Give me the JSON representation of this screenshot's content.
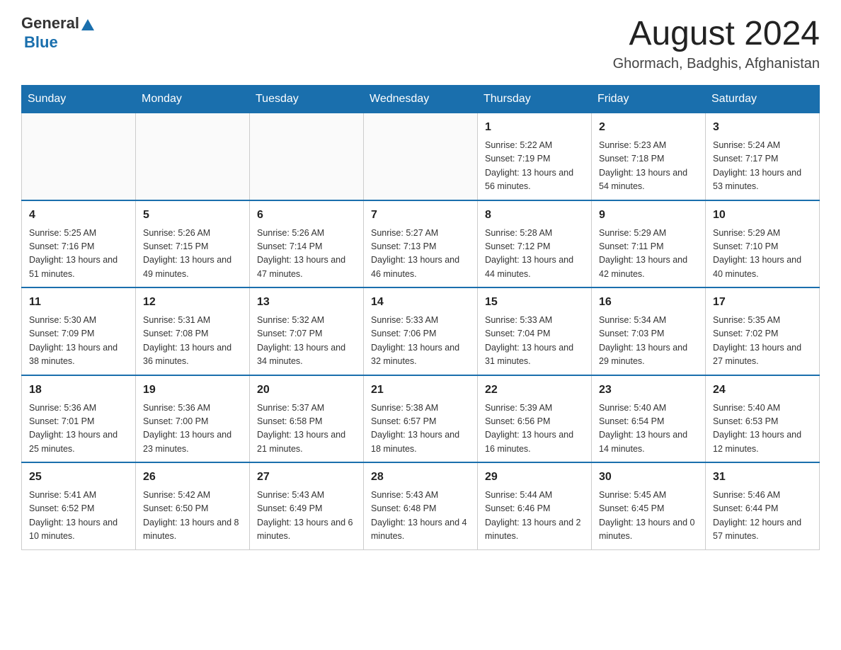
{
  "header": {
    "logo": {
      "general": "General",
      "blue": "Blue"
    },
    "title": "August 2024",
    "location": "Ghormach, Badghis, Afghanistan"
  },
  "days_of_week": [
    "Sunday",
    "Monday",
    "Tuesday",
    "Wednesday",
    "Thursday",
    "Friday",
    "Saturday"
  ],
  "weeks": [
    {
      "days": [
        {
          "number": "",
          "info": ""
        },
        {
          "number": "",
          "info": ""
        },
        {
          "number": "",
          "info": ""
        },
        {
          "number": "",
          "info": ""
        },
        {
          "number": "1",
          "info": "Sunrise: 5:22 AM\nSunset: 7:19 PM\nDaylight: 13 hours and 56 minutes."
        },
        {
          "number": "2",
          "info": "Sunrise: 5:23 AM\nSunset: 7:18 PM\nDaylight: 13 hours and 54 minutes."
        },
        {
          "number": "3",
          "info": "Sunrise: 5:24 AM\nSunset: 7:17 PM\nDaylight: 13 hours and 53 minutes."
        }
      ]
    },
    {
      "days": [
        {
          "number": "4",
          "info": "Sunrise: 5:25 AM\nSunset: 7:16 PM\nDaylight: 13 hours and 51 minutes."
        },
        {
          "number": "5",
          "info": "Sunrise: 5:26 AM\nSunset: 7:15 PM\nDaylight: 13 hours and 49 minutes."
        },
        {
          "number": "6",
          "info": "Sunrise: 5:26 AM\nSunset: 7:14 PM\nDaylight: 13 hours and 47 minutes."
        },
        {
          "number": "7",
          "info": "Sunrise: 5:27 AM\nSunset: 7:13 PM\nDaylight: 13 hours and 46 minutes."
        },
        {
          "number": "8",
          "info": "Sunrise: 5:28 AM\nSunset: 7:12 PM\nDaylight: 13 hours and 44 minutes."
        },
        {
          "number": "9",
          "info": "Sunrise: 5:29 AM\nSunset: 7:11 PM\nDaylight: 13 hours and 42 minutes."
        },
        {
          "number": "10",
          "info": "Sunrise: 5:29 AM\nSunset: 7:10 PM\nDaylight: 13 hours and 40 minutes."
        }
      ]
    },
    {
      "days": [
        {
          "number": "11",
          "info": "Sunrise: 5:30 AM\nSunset: 7:09 PM\nDaylight: 13 hours and 38 minutes."
        },
        {
          "number": "12",
          "info": "Sunrise: 5:31 AM\nSunset: 7:08 PM\nDaylight: 13 hours and 36 minutes."
        },
        {
          "number": "13",
          "info": "Sunrise: 5:32 AM\nSunset: 7:07 PM\nDaylight: 13 hours and 34 minutes."
        },
        {
          "number": "14",
          "info": "Sunrise: 5:33 AM\nSunset: 7:06 PM\nDaylight: 13 hours and 32 minutes."
        },
        {
          "number": "15",
          "info": "Sunrise: 5:33 AM\nSunset: 7:04 PM\nDaylight: 13 hours and 31 minutes."
        },
        {
          "number": "16",
          "info": "Sunrise: 5:34 AM\nSunset: 7:03 PM\nDaylight: 13 hours and 29 minutes."
        },
        {
          "number": "17",
          "info": "Sunrise: 5:35 AM\nSunset: 7:02 PM\nDaylight: 13 hours and 27 minutes."
        }
      ]
    },
    {
      "days": [
        {
          "number": "18",
          "info": "Sunrise: 5:36 AM\nSunset: 7:01 PM\nDaylight: 13 hours and 25 minutes."
        },
        {
          "number": "19",
          "info": "Sunrise: 5:36 AM\nSunset: 7:00 PM\nDaylight: 13 hours and 23 minutes."
        },
        {
          "number": "20",
          "info": "Sunrise: 5:37 AM\nSunset: 6:58 PM\nDaylight: 13 hours and 21 minutes."
        },
        {
          "number": "21",
          "info": "Sunrise: 5:38 AM\nSunset: 6:57 PM\nDaylight: 13 hours and 18 minutes."
        },
        {
          "number": "22",
          "info": "Sunrise: 5:39 AM\nSunset: 6:56 PM\nDaylight: 13 hours and 16 minutes."
        },
        {
          "number": "23",
          "info": "Sunrise: 5:40 AM\nSunset: 6:54 PM\nDaylight: 13 hours and 14 minutes."
        },
        {
          "number": "24",
          "info": "Sunrise: 5:40 AM\nSunset: 6:53 PM\nDaylight: 13 hours and 12 minutes."
        }
      ]
    },
    {
      "days": [
        {
          "number": "25",
          "info": "Sunrise: 5:41 AM\nSunset: 6:52 PM\nDaylight: 13 hours and 10 minutes."
        },
        {
          "number": "26",
          "info": "Sunrise: 5:42 AM\nSunset: 6:50 PM\nDaylight: 13 hours and 8 minutes."
        },
        {
          "number": "27",
          "info": "Sunrise: 5:43 AM\nSunset: 6:49 PM\nDaylight: 13 hours and 6 minutes."
        },
        {
          "number": "28",
          "info": "Sunrise: 5:43 AM\nSunset: 6:48 PM\nDaylight: 13 hours and 4 minutes."
        },
        {
          "number": "29",
          "info": "Sunrise: 5:44 AM\nSunset: 6:46 PM\nDaylight: 13 hours and 2 minutes."
        },
        {
          "number": "30",
          "info": "Sunrise: 5:45 AM\nSunset: 6:45 PM\nDaylight: 13 hours and 0 minutes."
        },
        {
          "number": "31",
          "info": "Sunrise: 5:46 AM\nSunset: 6:44 PM\nDaylight: 12 hours and 57 minutes."
        }
      ]
    }
  ]
}
